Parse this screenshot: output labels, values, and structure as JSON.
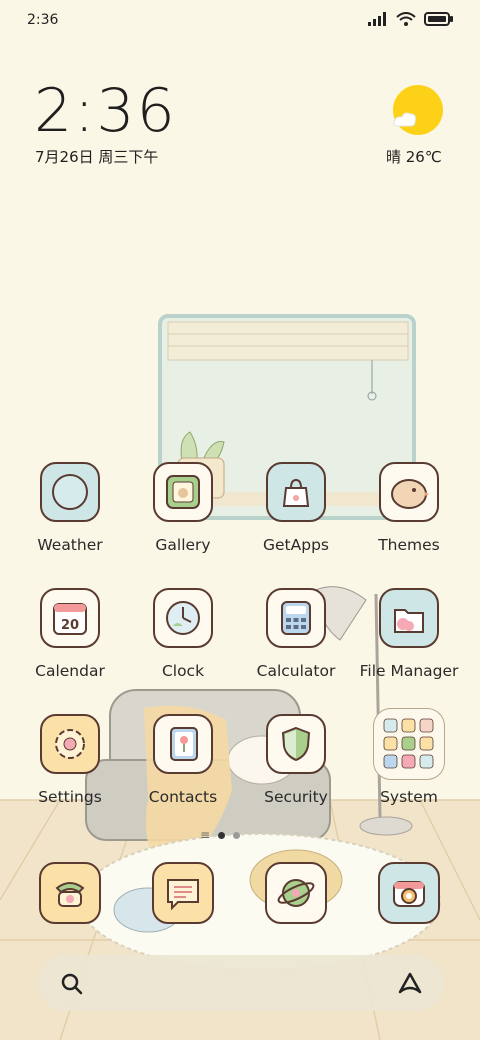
{
  "status_bar": {
    "time": "2:36"
  },
  "clock_widget": {
    "time": "2:36",
    "date": "7月26日 周三下午"
  },
  "weather_widget": {
    "text": "晴 26℃"
  },
  "apps": [
    {
      "label": "Weather"
    },
    {
      "label": "Gallery"
    },
    {
      "label": "GetApps"
    },
    {
      "label": "Themes"
    },
    {
      "label": "Calendar"
    },
    {
      "label": "Clock"
    },
    {
      "label": "Calculator"
    },
    {
      "label": "File Manager"
    },
    {
      "label": "Settings"
    },
    {
      "label": "Contacts"
    },
    {
      "label": "Security"
    },
    {
      "label": "System"
    }
  ],
  "calendar_icon": {
    "day": "20"
  },
  "page_indicator": {
    "pages": 2,
    "active": 1
  },
  "colors": {
    "background": "#fbf7e6",
    "icon_border": "#5a3b31",
    "sun": "#fdd117"
  },
  "icons": [
    "signal-icon",
    "wifi-icon",
    "battery-icon",
    "sun-icon",
    "search-icon",
    "assistant-icon"
  ]
}
